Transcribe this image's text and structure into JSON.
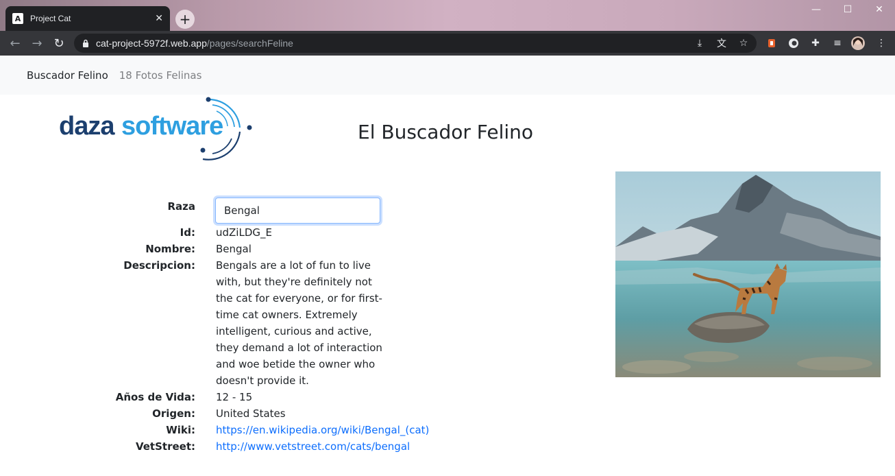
{
  "browser": {
    "tab_title": "Project Cat",
    "tab_favicon_letter": "A",
    "tab_close": "✕",
    "new_tab": "+",
    "url_host": "cat-project-5972f.web.app",
    "url_path": "/pages/searchFeline",
    "window_minimize": "—",
    "window_maximize": "☐",
    "window_close": "✕"
  },
  "navbar": {
    "brand": "Buscador Felino",
    "link": "18 Fotos Felinas"
  },
  "logo": {
    "text_daza": "daza",
    "text_software": "software"
  },
  "page": {
    "title": "El Buscador Felino"
  },
  "breed_form": {
    "raza_label": "Raza",
    "raza_value": "Bengal"
  },
  "details": {
    "id_label": "Id:",
    "id_value": "udZiLDG_E",
    "name_label": "Nombre:",
    "name_value": "Bengal",
    "description_label": "Descripcion:",
    "description_value": "Bengals are a lot of fun to live with, but they're definitely not the cat for everyone, or for first-time cat owners. Extremely intelligent, curious and active, they demand a lot of interaction and woe betide the owner who doesn't provide it.",
    "life_label": "Años de Vida:",
    "life_value": "12 - 15",
    "origin_label": "Origen:",
    "origin_value": "United States",
    "wiki_label": "Wiki:",
    "wiki_value": "https://en.wikipedia.org/wiki/Bengal_(cat)",
    "vetstreet_label": "VetStreet:",
    "vetstreet_value": "http://www.vetstreet.com/cats/bengal"
  },
  "colors": {
    "link": "#0d6efd",
    "navbar_bg": "#f8f9fa",
    "logo_dark": "#1c3f6e",
    "logo_light": "#2e9fe0"
  }
}
